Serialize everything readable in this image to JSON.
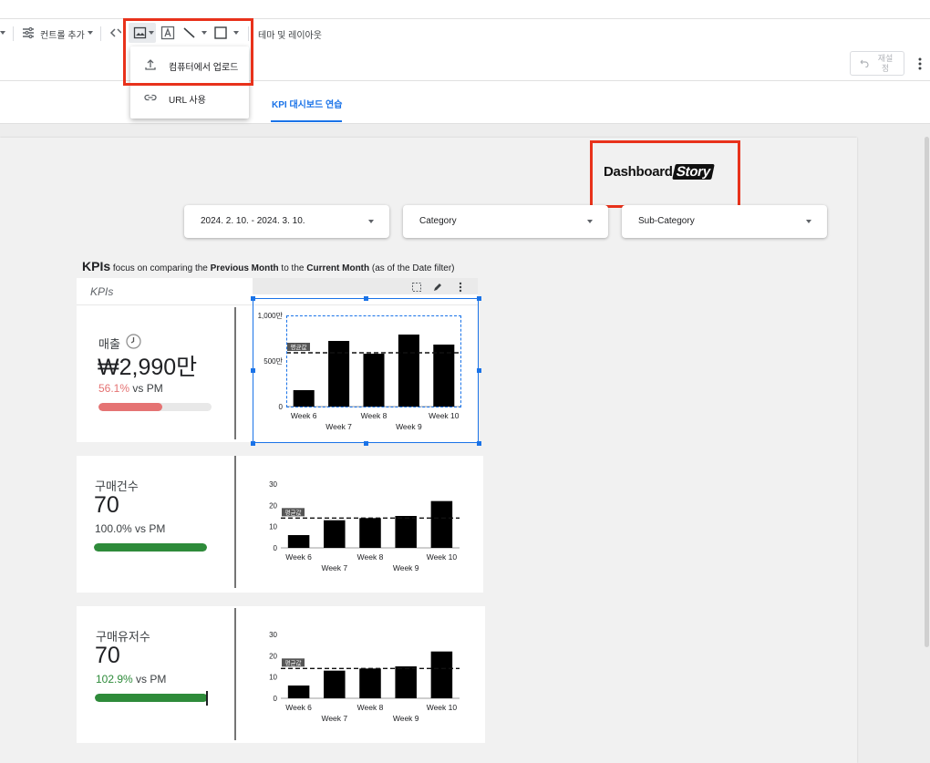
{
  "toolbar": {
    "add_control_label": "컨트롤 추가",
    "theme_layout_label": "테마 및 레이아웃"
  },
  "subbar": {
    "reset_label": "재설정"
  },
  "image_menu": {
    "items": [
      {
        "label": "컴퓨터에서 업로드",
        "icon": "upload-icon"
      },
      {
        "label": "URL 사용",
        "icon": "link-icon"
      }
    ]
  },
  "page_tab": {
    "label": "KPI 대시보드 연습"
  },
  "logo": {
    "text": "Dashboard",
    "text_highlight": "Story"
  },
  "filters": [
    {
      "label": "2024. 2. 10. - 2024. 3. 10."
    },
    {
      "label": "Category"
    },
    {
      "label": "Sub-Category"
    }
  ],
  "heading": {
    "big": "KPIs",
    "part1": " focus on comparing the ",
    "bold1": "Previous Month",
    "part2": " to the ",
    "bold2": "Current Month",
    "part3": " (as of the Date filter)"
  },
  "kpi_card_header": "KPIs",
  "colors": {
    "accent": "#1a73e8",
    "red_box": "#e8321b",
    "negative": "#e57373",
    "positive": "#2e8b3a"
  },
  "kpis": [
    {
      "label": "매출",
      "value": "₩2,990만",
      "pct": "56.1%",
      "vs": " vs PM",
      "progress": 0.561,
      "color": "#e57373",
      "pct_color": "#e57373"
    },
    {
      "label": "구매건수",
      "value": "70",
      "pct": "100.0%",
      "vs": " vs PM",
      "progress": 1.0,
      "color": "#2e8b3a",
      "pct_color": "#3c4043"
    },
    {
      "label": "구매유저수",
      "value": "70",
      "pct": "102.9%",
      "vs": " vs PM",
      "progress": 1.0,
      "color": "#2e8b3a",
      "pct_color": "#2e8b3a"
    }
  ],
  "chart_data": [
    {
      "type": "bar",
      "categories": [
        "Week 6",
        "Week 7",
        "Week 8",
        "Week 9",
        "Week 10"
      ],
      "values": [
        180,
        720,
        580,
        790,
        680
      ],
      "ylim": [
        0,
        1000
      ],
      "yticks": [
        "0",
        "500만",
        "1,000만"
      ],
      "average": 590,
      "average_label": "평균값"
    },
    {
      "type": "bar",
      "categories": [
        "Week 6",
        "Week 7",
        "Week 8",
        "Week 9",
        "Week 10"
      ],
      "values": [
        6,
        13,
        14,
        15,
        22
      ],
      "ylim": [
        0,
        30
      ],
      "yticks": [
        "0",
        "10",
        "20",
        "30"
      ],
      "average": 14,
      "average_label": "평균값"
    },
    {
      "type": "bar",
      "categories": [
        "Week 6",
        "Week 7",
        "Week 8",
        "Week 9",
        "Week 10"
      ],
      "values": [
        6,
        13,
        14,
        15,
        22
      ],
      "ylim": [
        0,
        30
      ],
      "yticks": [
        "0",
        "10",
        "20",
        "30"
      ],
      "average": 14,
      "average_label": "평균값"
    }
  ]
}
